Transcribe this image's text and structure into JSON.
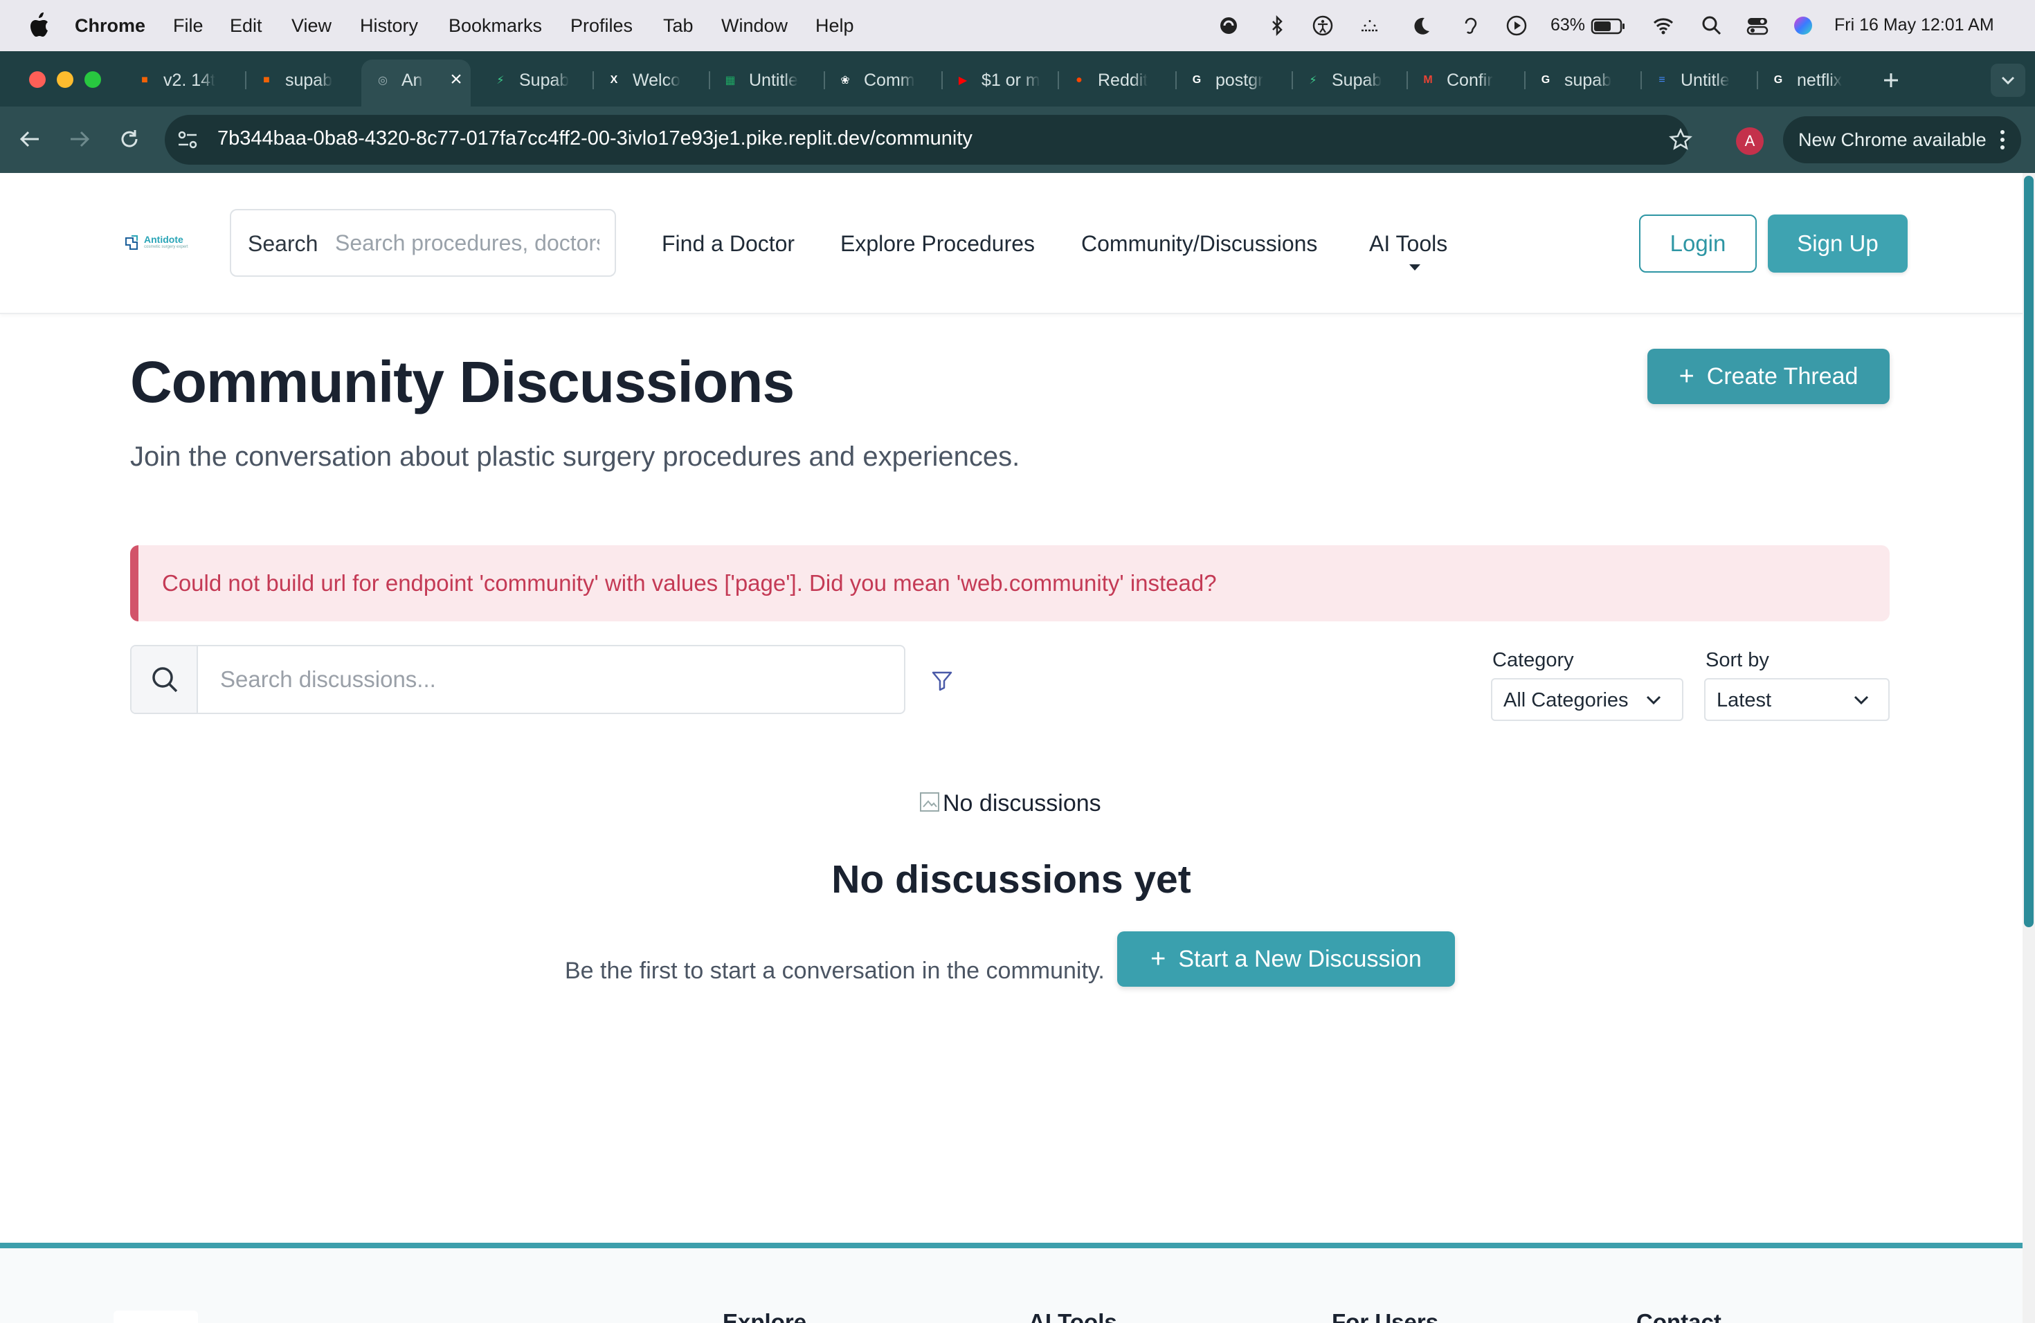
{
  "menubar": {
    "app": "Chrome",
    "items": [
      "File",
      "Edit",
      "View",
      "History",
      "Bookmarks",
      "Profiles",
      "Tab",
      "Window",
      "Help"
    ],
    "battery": "63%",
    "datetime": "Fri 16 May  12:01 AM"
  },
  "tabs": [
    {
      "title": "v2. 14t",
      "icon": "replit-icon",
      "color": "#f26207"
    },
    {
      "title": "supab",
      "icon": "replit-icon",
      "color": "#f26207"
    },
    {
      "title": "An",
      "icon": "globe-icon",
      "color": "#9fb3b6",
      "active": true
    },
    {
      "title": "Supab",
      "icon": "supabase-icon",
      "color": "#3ecf8e"
    },
    {
      "title": "Welco",
      "icon": "x-icon",
      "color": "#ffffff"
    },
    {
      "title": "Untitle",
      "icon": "sheets-icon",
      "color": "#1fa463"
    },
    {
      "title": "Comm",
      "icon": "openai-icon",
      "color": "#ffffff"
    },
    {
      "title": "$1 or m",
      "icon": "youtube-icon",
      "color": "#ff0000"
    },
    {
      "title": "Reddit",
      "icon": "reddit-icon",
      "color": "#ff4500"
    },
    {
      "title": "postgr",
      "icon": "google-icon",
      "color": "#ffffff"
    },
    {
      "title": "Supab",
      "icon": "supabase-icon",
      "color": "#3ecf8e"
    },
    {
      "title": "Confir",
      "icon": "gmail-icon",
      "color": "#ea4335"
    },
    {
      "title": "supab",
      "icon": "google-icon",
      "color": "#ffffff"
    },
    {
      "title": "Untitle",
      "icon": "docs-icon",
      "color": "#4285f4"
    },
    {
      "title": "netflix",
      "icon": "google-icon",
      "color": "#ffffff"
    }
  ],
  "toolbar": {
    "url": "7b344baa-0ba8-4320-8c77-017fa7cc4ff2-00-3ivlo17e93je1.pike.replit.dev/community",
    "profile_initial": "A",
    "new_chrome": "New Chrome available"
  },
  "header": {
    "logo_text": "Antidote",
    "logo_sub": "cosmetic surgery expert",
    "search_label": "Search",
    "search_placeholder": "Search procedures, doctors...",
    "nav": [
      "Find a Doctor",
      "Explore Procedures",
      "Community/Discussions",
      "AI Tools"
    ],
    "login": "Login",
    "signup": "Sign Up"
  },
  "main": {
    "title": "Community Discussions",
    "subtitle": "Join the conversation about plastic surgery procedures and experiences.",
    "create_button": "Create Thread",
    "error": "Could not build url for endpoint 'community' with values ['page']. Did you mean 'web.community' instead?",
    "search_placeholder": "Search discussions...",
    "category_label": "Category",
    "category_value": "All Categories",
    "sort_label": "Sort by",
    "sort_value": "Latest",
    "empty_image_alt": "No discussions",
    "empty_title": "No discussions yet",
    "empty_text": "Be the first to start a conversation in the community.",
    "start_button": "Start a New Discussion"
  },
  "footer": {
    "headings": [
      "Explore",
      "AI Tools",
      "For Users",
      "Contact"
    ]
  },
  "colors": {
    "accent": "#3a9aa8",
    "error_text": "#c43a55",
    "error_bg": "#fbe9ec",
    "tabstrip": "#1f3f43"
  }
}
